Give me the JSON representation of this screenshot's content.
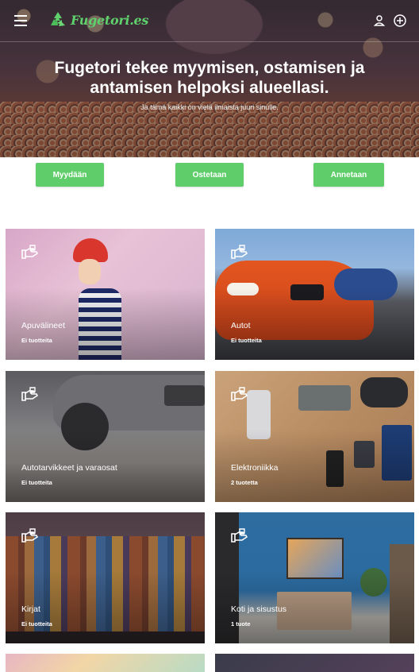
{
  "header": {
    "brand": "Fugetori.es",
    "icons": [
      "menu-icon",
      "recycle-logo-icon",
      "user-icon",
      "add-circle-icon"
    ],
    "accent_color": "#5fce6a"
  },
  "hero": {
    "title": "Fugetori tekee myymisen, ostamisen ja antamisen helpoksi alueellasi.",
    "subtitle": "Ja tämä kaikki on vielä ilmaista juuri sinulle."
  },
  "actions": {
    "sell": "Myydään",
    "buy": "Ostetaan",
    "give": "Annetaan"
  },
  "categories": [
    {
      "name": "Apuvälineet",
      "count": "Ei tuotteita"
    },
    {
      "name": "Autot",
      "count": "Ei tuotteita"
    },
    {
      "name": "Autotarvikkeet ja varaosat",
      "count": "Ei tuotteita"
    },
    {
      "name": "Elektroniikka",
      "count": "2 tuotetta"
    },
    {
      "name": "Kirjat",
      "count": "Ei tuotteita"
    },
    {
      "name": "Koti ja sisustus",
      "count": "1 tuote"
    },
    {
      "name": "",
      "count": ""
    },
    {
      "name": "",
      "count": ""
    }
  ]
}
